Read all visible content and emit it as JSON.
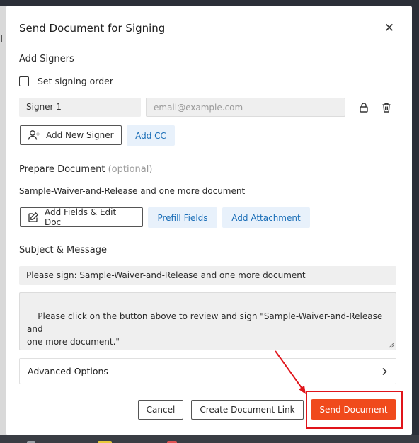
{
  "modal": {
    "title": "Send Document for Signing",
    "close_icon": "close-icon"
  },
  "signers": {
    "heading": "Add Signers",
    "signing_order_label": "Set signing order",
    "signing_order_checked": false,
    "signer_name": "Signer 1",
    "email_placeholder": "email@example.com",
    "email_value": "",
    "lock_icon": "lock-icon",
    "delete_icon": "trash-icon",
    "add_signer_label": "Add New Signer",
    "add_signer_icon": "add-user-icon",
    "add_cc_label": "Add CC"
  },
  "prepare": {
    "heading": "Prepare Document",
    "optional_label": "(optional)",
    "documents_text": "Sample-Waiver-and-Release and one more document",
    "edit_doc_label": "Add Fields & Edit Doc",
    "edit_doc_icon": "edit-icon",
    "prefill_label": "Prefill Fields",
    "attachment_label": "Add Attachment"
  },
  "message": {
    "heading": "Subject & Message",
    "subject": "Please sign: Sample-Waiver-and-Release and one more document",
    "body": "Please click on the button above to review and sign \"Sample-Waiver-and-Release and\none more document.\""
  },
  "advanced": {
    "label": "Advanced Options",
    "chevron_icon": "chevron-right-icon"
  },
  "footer": {
    "cancel_label": "Cancel",
    "create_link_label": "Create Document Link",
    "send_label": "Send Document"
  },
  "colors": {
    "accent": "#f04a1c",
    "tint_button_bg": "#e8f1fb",
    "tint_button_text": "#1c6fb8",
    "annotation_red": "#e0141a"
  }
}
